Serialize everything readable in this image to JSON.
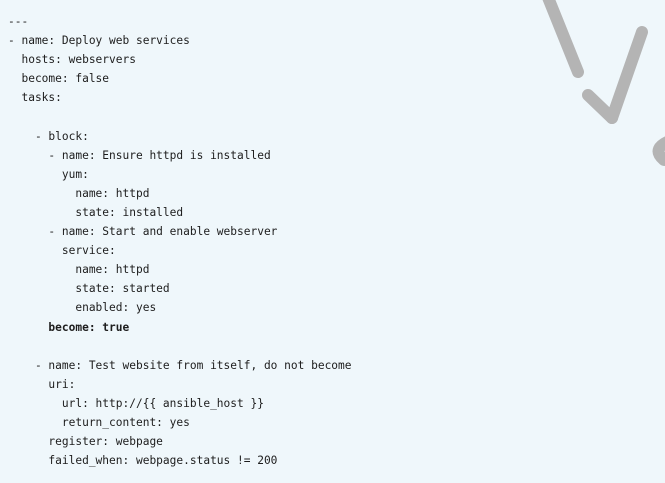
{
  "code": {
    "lines": [
      {
        "text": "---",
        "bold": false
      },
      {
        "text": "- name: Deploy web services",
        "bold": false
      },
      {
        "text": "  hosts: webservers",
        "bold": false
      },
      {
        "text": "  become: false",
        "bold": false
      },
      {
        "text": "  tasks:",
        "bold": false
      },
      {
        "text": "",
        "bold": false
      },
      {
        "text": "    - block:",
        "bold": false
      },
      {
        "text": "      - name: Ensure httpd is installed",
        "bold": false
      },
      {
        "text": "        yum:",
        "bold": false
      },
      {
        "text": "          name: httpd",
        "bold": false
      },
      {
        "text": "          state: installed",
        "bold": false
      },
      {
        "text": "      - name: Start and enable webserver",
        "bold": false
      },
      {
        "text": "        service:",
        "bold": false
      },
      {
        "text": "          name: httpd",
        "bold": false
      },
      {
        "text": "          state: started",
        "bold": false
      },
      {
        "text": "          enabled: yes",
        "bold": false
      },
      {
        "text": "      become: true",
        "bold": true
      },
      {
        "text": "",
        "bold": false
      },
      {
        "text": "    - name: Test website from itself, do not become",
        "bold": false
      },
      {
        "text": "      uri:",
        "bold": false
      },
      {
        "text": "        url: http://{{ ansible_host }}",
        "bold": false
      },
      {
        "text": "        return_content: yes",
        "bold": false
      },
      {
        "text": "      register: webpage",
        "bold": false
      },
      {
        "text": "      failed_when: webpage.status != 200",
        "bold": false
      }
    ]
  },
  "colors": {
    "background": "#eff7fb",
    "text": "#1d1d1d",
    "watermark": "#b4b4b4"
  }
}
